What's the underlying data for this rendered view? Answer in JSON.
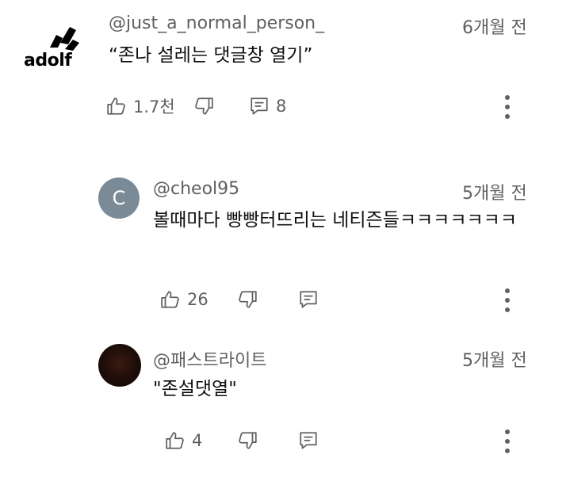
{
  "comments": [
    {
      "avatar_text": "adolf",
      "handle": "@just_a_normal_person_",
      "time": "6개월 전",
      "text": "“존나 설레는 댓글창 열기”",
      "likes": "1.7천",
      "replies": "8"
    },
    {
      "avatar_letter": "C",
      "avatar_color": "#7b8a97",
      "handle": "@cheol95",
      "time": "5개월 전",
      "text": "볼때마다 빵빵터뜨리는 네티즌들ㅋㅋㅋㅋㅋㅋㅋ",
      "likes": "26"
    },
    {
      "avatar_color": "#1d0d08",
      "handle": "@패스트라이트",
      "time": "5개월 전",
      "text": "\"존설댓열\"",
      "likes": "4"
    }
  ]
}
